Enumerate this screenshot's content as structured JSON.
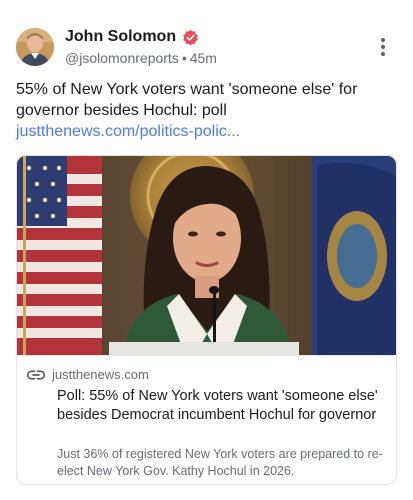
{
  "post": {
    "author": {
      "name": "John Solomon",
      "handle": "@jsolomonreports",
      "separator": "•",
      "time": "45m",
      "avatar_icon": "person-avatar",
      "verified_icon": "verified-badge-icon",
      "verified_color": "#ec4b5a"
    },
    "menu_icon": "more-vertical-icon",
    "text": "55% of New York voters want 'someone else' for governor besides Hochul: poll ",
    "link_text": "justthenews.com/politics-polic...",
    "link_color": "#4d7cf0"
  },
  "card": {
    "image_alt": "news-photo",
    "link_icon": "link-icon",
    "domain": "justthenews.com",
    "title": "Poll: 55% of New York voters want 'someone else' besides Democrat incumbent Hochul for governor",
    "description": "Just 36% of registered New York voters are prepared to re-elect New York Gov. Kathy Hochul in 2026."
  }
}
